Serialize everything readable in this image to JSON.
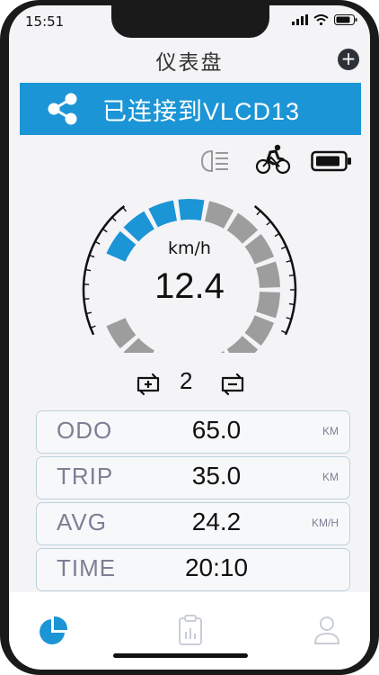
{
  "status": {
    "time": "15:51"
  },
  "header": {
    "title": "仪表盘",
    "add_label": "+"
  },
  "connection": {
    "text": "已连接到VLCD13"
  },
  "speed": {
    "unit": "km/h",
    "value": "12.4",
    "gauge_fill_fraction": 0.28
  },
  "assist": {
    "level": "2"
  },
  "stats": [
    {
      "label": "ODO",
      "value": "65.0",
      "unit": "KM"
    },
    {
      "label": "TRIP",
      "value": "35.0",
      "unit": "KM"
    },
    {
      "label": "AVG",
      "value": "24.2",
      "unit": "KM/H"
    },
    {
      "label": "TIME",
      "value": "20:10",
      "unit": ""
    }
  ],
  "colors": {
    "accent": "#1c95d6",
    "gauge_inactive": "#9d9d9d",
    "label": "#7b8094"
  },
  "icons": {
    "headlight": "headlight-icon",
    "cyclist": "cyclist-icon",
    "battery": "battery-icon",
    "share": "share-icon",
    "assist_up": "assist-up-icon",
    "assist_down": "assist-down-icon",
    "tab_dashboard": "dashboard-tab-icon",
    "tab_records": "records-tab-icon",
    "tab_profile": "profile-tab-icon"
  }
}
